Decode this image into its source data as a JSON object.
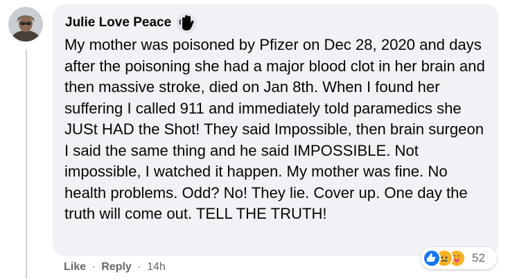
{
  "comment": {
    "author": "Julie Love Peace",
    "badge_icon": "hand-wave-icon",
    "text": "My mother was poisoned by Pfizer on Dec 28, 2020 and days after the poisoning she had a major blood clot in her brain and then massive stroke, died on Jan 8th. When I found her suffering I called 911 and immediately told paramedics she JUSt HAD the Shot! They said Impossible, then brain surgeon I said the same thing and he said IMPOSSIBLE. Not impossible, I watched it happen. My mother was fine. No health problems. Odd? No! They lie. Cover up. One day the truth will come out. TELL THE TRUTH!",
    "reaction_icons": [
      "like-icon",
      "sad-icon",
      "care-icon"
    ],
    "reaction_count": "52"
  },
  "actions": {
    "like": "Like",
    "separator": "·",
    "reply": "Reply",
    "timestamp": "14h"
  },
  "colors": {
    "bubble": "#f0f2f5",
    "text": "#050505",
    "secondary_text": "#65676b",
    "like_blue": "#1877f2",
    "emoji_yellow": "#f7b125"
  }
}
